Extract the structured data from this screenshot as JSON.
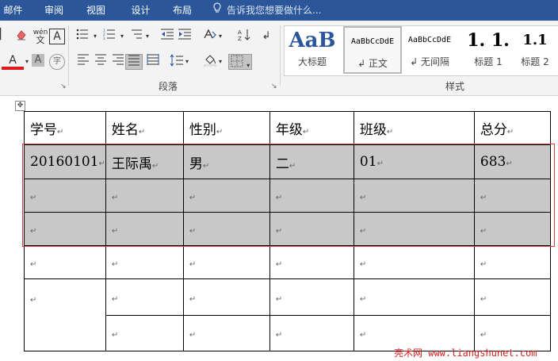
{
  "tabs": [
    "邮件",
    "审阅",
    "视图",
    "设计",
    "布局"
  ],
  "tell_me": "告诉我您想要做什么...",
  "groups": {
    "paragraph": "段落",
    "styles": "样式"
  },
  "font_buttons": {
    "pinyin": "wén",
    "font_color_letter": "A",
    "shading_letter": "A",
    "enclose_char": "字"
  },
  "styles": [
    {
      "preview": "AaB",
      "name": "大标题"
    },
    {
      "preview": "AaBbCcDdE",
      "name": "↲ 正文"
    },
    {
      "preview": "AaBbCcDdE",
      "name": "↲ 无间隔"
    },
    {
      "preview": "1. 1.",
      "name": "标题 1"
    },
    {
      "preview": "1.1",
      "name": "标题 2"
    }
  ],
  "table": {
    "headers": [
      "学号",
      "姓名",
      "性别",
      "年级",
      "班级",
      "总分"
    ],
    "first_row": [
      "20160101",
      "王际禹",
      "男",
      "二",
      "01",
      "683"
    ],
    "para_mark": "↵"
  },
  "watermark": "亮术网 www.liangshunet.com",
  "colors": {
    "ribbon_blue": "#2b579a",
    "active_tab": "#1e4079",
    "selection_gray": "#c8c8c8",
    "selection_outline": "#e23b3b",
    "font_color_red": "#e01a1a",
    "watermark_red": "#d9201f"
  }
}
